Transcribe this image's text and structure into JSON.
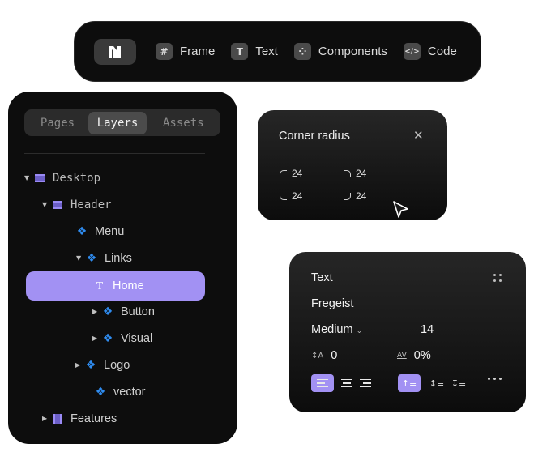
{
  "toolbar": {
    "tools": [
      {
        "label": "Frame",
        "icon": "hash-icon",
        "glyph": "#"
      },
      {
        "label": "Text",
        "icon": "text-icon",
        "glyph": "T"
      },
      {
        "label": "Components",
        "icon": "components-icon",
        "glyph": "⁘"
      },
      {
        "label": "Code",
        "icon": "code-icon",
        "glyph": "</>"
      }
    ]
  },
  "layers": {
    "tabs": [
      "Pages",
      "Layers",
      "Assets"
    ],
    "active_tab": "Layers",
    "items": [
      {
        "label": "Desktop",
        "icon": "frame-icon",
        "expanded": true
      },
      {
        "label": "Header",
        "icon": "frame-icon",
        "expanded": true
      },
      {
        "label": "Menu",
        "icon": "component-icon"
      },
      {
        "label": "Links",
        "icon": "component-icon",
        "expanded": true
      },
      {
        "label": "Home",
        "icon": "text-layer-icon",
        "selected": true
      },
      {
        "label": "Button",
        "icon": "component-icon",
        "expanded": false
      },
      {
        "label": "Visual",
        "icon": "component-icon",
        "expanded": false
      },
      {
        "label": "Logo",
        "icon": "component-icon",
        "expanded": false
      },
      {
        "label": "vector",
        "icon": "component-icon"
      },
      {
        "label": "Features",
        "icon": "frame-icon",
        "expanded": false
      }
    ]
  },
  "corner_radius": {
    "title": "Corner radius",
    "top_left": "24",
    "top_right": "24",
    "bottom_left": "24",
    "bottom_right": "24"
  },
  "text_panel": {
    "title": "Text",
    "font": "Fregeist",
    "weight": "Medium",
    "size": "14",
    "line_height": "0",
    "letter_spacing": "0%",
    "line_height_glyph": "↕A",
    "letter_spacing_glyph": "AV"
  },
  "colors": {
    "accent": "#a291f3",
    "component_blue": "#2f8cf0",
    "panel_bg": "#0d0d0d"
  }
}
